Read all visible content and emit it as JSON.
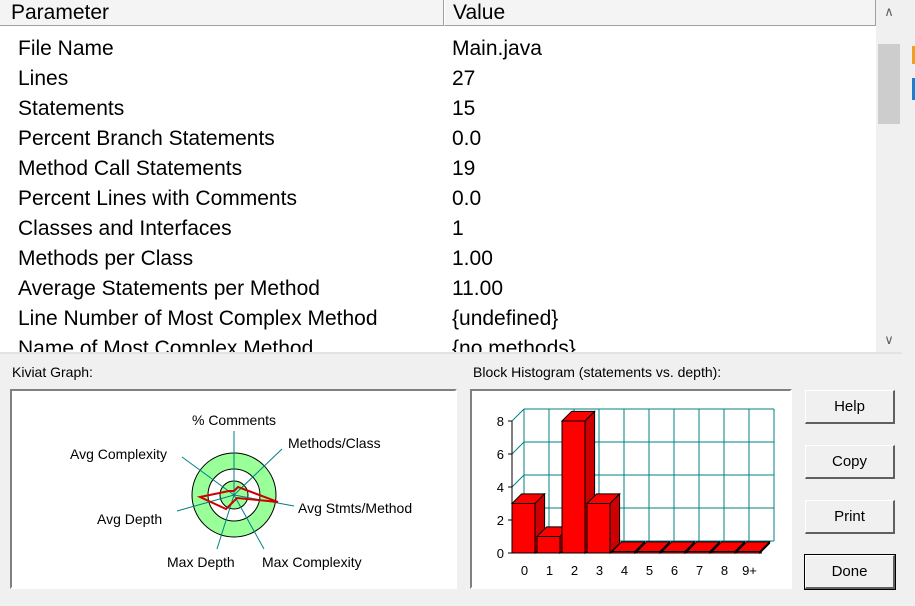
{
  "table": {
    "headers": [
      "Parameter",
      "Value"
    ],
    "rows": [
      {
        "param": "File Name",
        "value": "Main.java"
      },
      {
        "param": "Lines",
        "value": "27"
      },
      {
        "param": "Statements",
        "value": "15"
      },
      {
        "param": "Percent Branch Statements",
        "value": "0.0"
      },
      {
        "param": "Method Call Statements",
        "value": "19"
      },
      {
        "param": "Percent Lines with Comments",
        "value": "0.0"
      },
      {
        "param": "Classes and Interfaces",
        "value": "1"
      },
      {
        "param": "Methods per Class",
        "value": "1.00"
      },
      {
        "param": "Average Statements per Method",
        "value": "11.00"
      },
      {
        "param": "Line Number of Most Complex Method",
        "value": "{undefined}"
      },
      {
        "param": "Name of Most Complex Method",
        "value": "{no methods}"
      }
    ]
  },
  "kiviat": {
    "title": "Kiviat Graph:",
    "axes": [
      "% Comments",
      "Methods/Class",
      "Avg Stmts/Method",
      "Max Complexity",
      "Max Depth",
      "Avg Depth",
      "Avg Complexity"
    ]
  },
  "histogram": {
    "title": "Block Histogram (statements vs. depth):"
  },
  "chart_data": {
    "type": "bar",
    "categories": [
      "0",
      "1",
      "2",
      "3",
      "4",
      "5",
      "6",
      "7",
      "8",
      "9+"
    ],
    "values": [
      3,
      1,
      8,
      3,
      0,
      0,
      0,
      0,
      0,
      0
    ],
    "yticks": [
      "0",
      "2",
      "4",
      "6",
      "8"
    ],
    "ylim": [
      0,
      8
    ],
    "bar_color": "#ff0000"
  },
  "buttons": {
    "help": "Help",
    "copy": "Copy",
    "print": "Print",
    "done": "Done"
  },
  "colors": {
    "kiviat_ring": "#99ff99",
    "kiviat_line": "#cc0000",
    "grid": "#008080"
  }
}
